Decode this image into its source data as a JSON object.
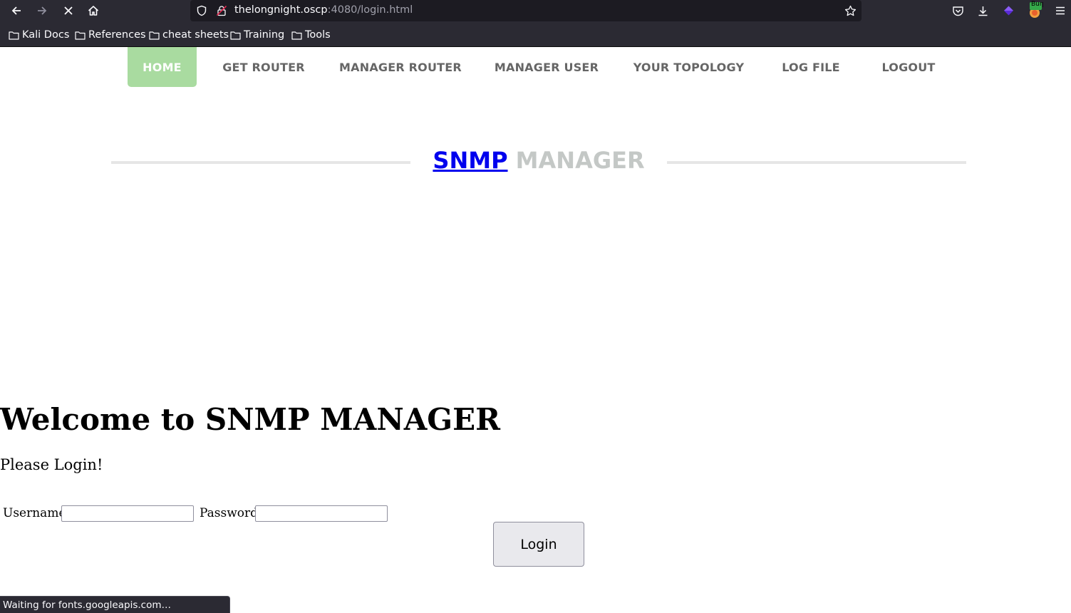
{
  "browser": {
    "url_host": "thelongnight.oscp",
    "url_rest": ":4080/login.html",
    "bookmarks": [
      {
        "label": "Kali Docs",
        "icon": "folder-icon"
      },
      {
        "label": "References",
        "icon": "folder-icon"
      },
      {
        "label": "cheat sheets",
        "icon": "folder-icon"
      },
      {
        "label": "Training",
        "icon": "folder-icon"
      },
      {
        "label": "Tools",
        "icon": "folder-icon"
      }
    ],
    "extension_badge": "Burp",
    "status_text": "Waiting for fonts.googleapis.com…"
  },
  "nav": {
    "items": [
      {
        "label": "HOME",
        "active": true
      },
      {
        "label": "GET ROUTER"
      },
      {
        "label": "MANAGER ROUTER"
      },
      {
        "label": "MANAGER USER"
      },
      {
        "label": "YOUR TOPOLOGY"
      },
      {
        "label": "LOG FILE"
      },
      {
        "label": "LOGOUT"
      }
    ],
    "active_color": "#a9dba0"
  },
  "logo": {
    "part1": "SNMP",
    "part2": "MANAGER"
  },
  "main": {
    "heading": "Welcome to SNMP MANAGER",
    "subheading": "Please Login!",
    "username_label": "Username",
    "password_label": "Password",
    "username_value": "",
    "password_value": "",
    "login_label": "Login"
  }
}
